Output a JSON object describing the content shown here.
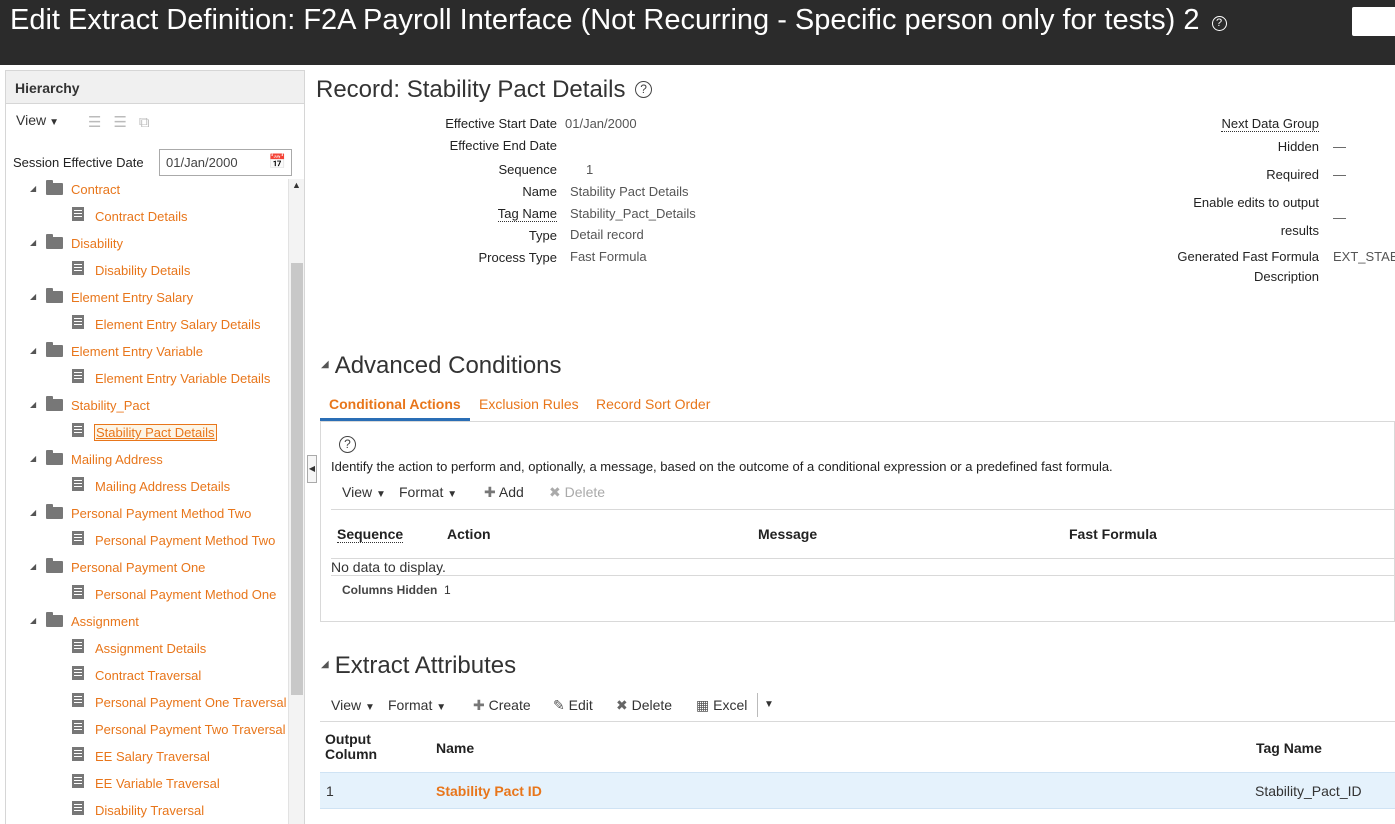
{
  "window": {
    "title": "Edit Extract Definition: F2A Payroll Interface (Not Recurring - Specific person only for tests) 2"
  },
  "hierarchy": {
    "header": "Hierarchy",
    "view_label": "View",
    "session_label": "Session Effective Date",
    "session_value": "01/Jan/2000",
    "nodes": [
      "Contract",
      "Contract Details",
      "Disability",
      "Disability Details",
      "Element Entry Salary",
      "Element Entry Salary Details",
      "Element Entry Variable",
      "Element Entry Variable Details",
      "Stability_Pact",
      "Stability Pact Details",
      "Mailing Address",
      "Mailing Address Details",
      "Personal Payment Method Two",
      "Personal Payment Method Two",
      "Personal Payment One",
      "Personal Payment Method One",
      "Assignment",
      "Assignment Details",
      "Contract Traversal",
      "Personal Payment One Traversal",
      "Personal Payment Two Traversal",
      "EE Salary Traversal",
      "EE Variable Traversal",
      "Disability Traversal"
    ]
  },
  "record": {
    "title": "Record: Stability Pact Details",
    "effective_start_label": "Effective Start Date",
    "effective_start_value": "01/Jan/2000",
    "effective_end_label": "Effective End Date",
    "sequence_label": "Sequence",
    "sequence_value": "1",
    "name_label": "Name",
    "name_value": "Stability Pact Details",
    "tag_label": "Tag Name",
    "tag_value": "Stability_Pact_Details",
    "type_label": "Type",
    "type_value": "Detail record",
    "process_label": "Process Type",
    "process_value": "Fast Formula",
    "next_group_label": "Next Data Group",
    "hidden_label": "Hidden",
    "hidden_value": "—",
    "required_label": "Required",
    "required_value": "—",
    "enable_edits_label_1": "Enable edits to output",
    "enable_edits_label_2": "results",
    "enable_edits_value": "—",
    "gff_label": "Generated Fast Formula",
    "gff_value": "EXT_STAB",
    "description_label": "Description"
  },
  "advanced": {
    "title": "Advanced Conditions",
    "tabs": [
      "Conditional Actions",
      "Exclusion Rules",
      "Record Sort Order"
    ],
    "description": "Identify the action to perform and, optionally, a message, based on the outcome of a conditional expression or a predefined fast formula.",
    "toolbar": {
      "view": "View",
      "format": "Format",
      "add": "Add",
      "delete": "Delete"
    },
    "columns": [
      "Sequence",
      "Action",
      "Message",
      "Fast Formula"
    ],
    "empty_text": "No data to display.",
    "columns_hidden_label": "Columns Hidden",
    "columns_hidden_value": "1"
  },
  "attributes": {
    "title": "Extract Attributes",
    "toolbar": {
      "view": "View",
      "format": "Format",
      "create": "Create",
      "edit": "Edit",
      "delete": "Delete",
      "excel": "Excel"
    },
    "col_output_1": "Output",
    "col_output_2": "Column",
    "col_name": "Name",
    "col_tag": "Tag Name",
    "rows": [
      {
        "output_column": "1",
        "name": "Stability Pact ID",
        "tag_name": "Stability_Pact_ID"
      }
    ]
  }
}
